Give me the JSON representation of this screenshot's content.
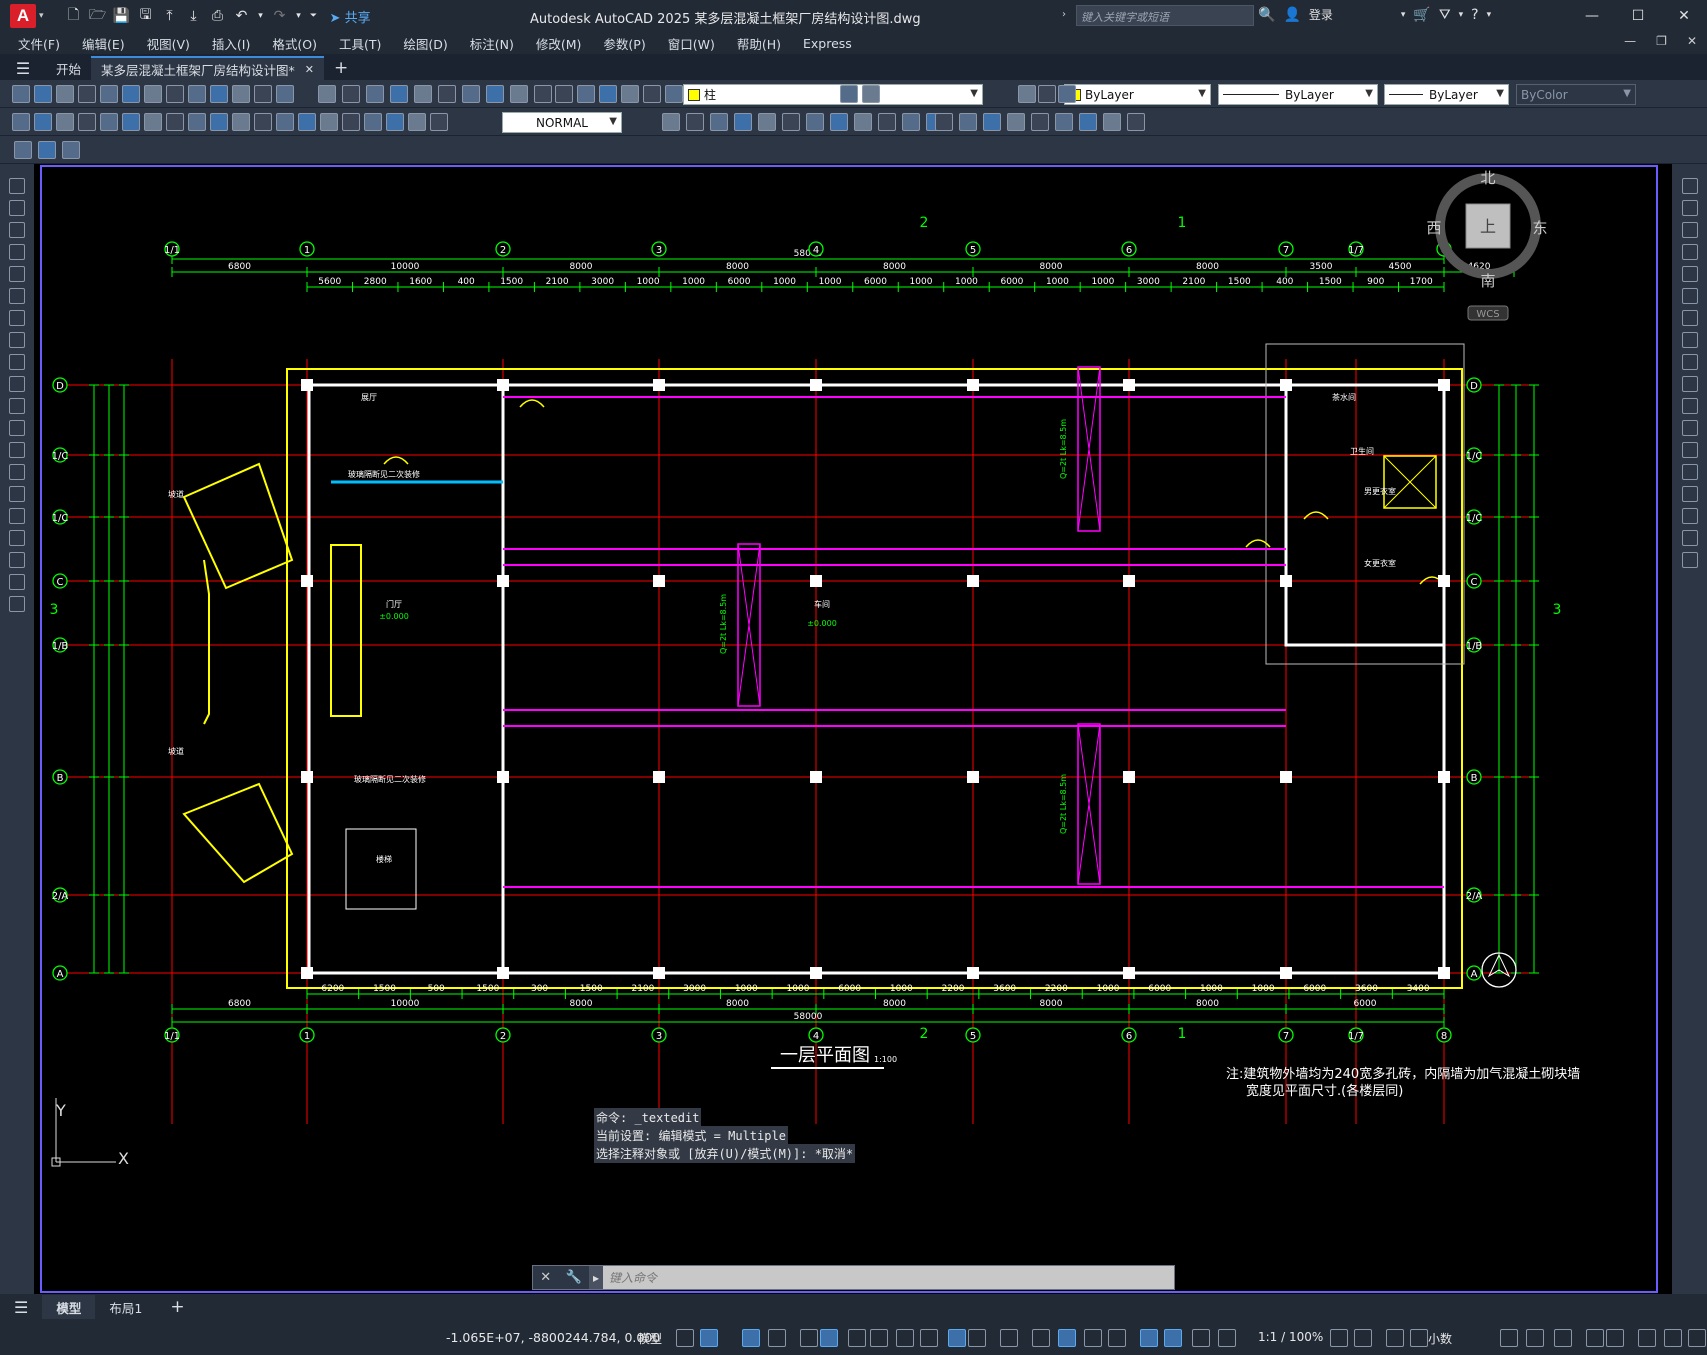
{
  "app": {
    "title": "Autodesk AutoCAD 2025    某多层混凝土框架厂房结构设计图.dwg",
    "logo": "A",
    "share": "共享",
    "search_placeholder": "键入关键字或短语",
    "login": "登录",
    "search_icon": "search-icon",
    "colors": {
      "accent": "#3c8cdc",
      "canvas": "#000000",
      "ui": "#2d3645",
      "axis_green": "#00ff00",
      "wall_yellow": "#ffff00",
      "grid_red": "#ff0000",
      "beam_magenta": "#ff00ff"
    }
  },
  "menu": [
    "文件(F)",
    "编辑(E)",
    "视图(V)",
    "插入(I)",
    "格式(O)",
    "工具(T)",
    "绘图(D)",
    "标注(N)",
    "修改(M)",
    "参数(P)",
    "窗口(W)",
    "帮助(H)",
    "Express"
  ],
  "tabs": {
    "start": "开始",
    "doc": "某多层混凝土框架厂房结构设计图*",
    "add": "+"
  },
  "toolbar": {
    "layer": "柱",
    "color": "ByLayer",
    "linetype": "ByLayer",
    "lineweight": "ByLayer",
    "plotstyle": "ByColor",
    "textstyle": "NORMAL"
  },
  "drawing": {
    "title": "一层平面图",
    "scale": "1:100",
    "note_line1": "注:建筑物外墙均为240宽多孔砖，内隔墙为加气混凝土砌块墙",
    "note_line2": "宽度见平面尺寸.(各楼层同)",
    "axes_x": [
      "1/1",
      "1",
      "2",
      "3",
      "4",
      "5",
      "6",
      "7",
      "1/7",
      "8"
    ],
    "axes_y": [
      "D",
      "1/C",
      "1/C",
      "C",
      "1/B",
      "B",
      "2/A",
      "A"
    ],
    "dims_top_total": "58000",
    "dims_top_row2": [
      "6800",
      "10000",
      "8000",
      "8000",
      "8000",
      "8000",
      "8000",
      "3500",
      "4500",
      "4620"
    ],
    "dims_top_row3": [
      "5600",
      "2800",
      "1600",
      "400",
      "1500",
      "2100",
      "3000",
      "1000",
      "1000",
      "6000",
      "1000",
      "1000",
      "6000",
      "1000",
      "1000",
      "6000",
      "1000",
      "1000",
      "3000",
      "2100",
      "1500",
      "400",
      "1500",
      "900",
      "1700"
    ],
    "dims_bottom_row1": [
      "6200",
      "1500",
      "500",
      "1500",
      "300",
      "1500",
      "2100",
      "3000",
      "1000",
      "1000",
      "6000",
      "1000",
      "2200",
      "3600",
      "2200",
      "1000",
      "6000",
      "1000",
      "1000",
      "6000",
      "3600",
      "3400"
    ],
    "dims_bottom_row2": [
      "6800",
      "10000",
      "8000",
      "8000",
      "8000",
      "8000",
      "8000",
      "6000"
    ],
    "dims_bottom_total": "58000",
    "rooms": {
      "hall": "展厅",
      "lobby": "门厅",
      "workshop": "车间",
      "stair": "楼梯",
      "ramp": "坡道",
      "toilet_m": "男更衣室",
      "toilet_f": "女更衣室",
      "tea": "茶水间",
      "wc": "卫生间"
    },
    "level_lobby": "±0.000",
    "level_workshop": "±0.000",
    "crane_text": "Q=2t Lk=8.5m",
    "compass": {
      "north": "北",
      "south": "南",
      "east": "东",
      "west": "西",
      "top": "上",
      "wcs": "WCS"
    },
    "side_labels": {
      "left": "3",
      "right": "3",
      "sec_top_2": "2",
      "sec_top_1": "1",
      "sec_bot_2": "2",
      "sec_bot_1": "1"
    },
    "glass_note": "玻璃隔断见二次装修"
  },
  "command": {
    "history": [
      "命令: _textedit",
      "当前设置: 编辑模式 = Multiple",
      "选择注释对象或 [放弃(U)/模式(M)]: *取消*"
    ],
    "placeholder": "键入命令"
  },
  "layouts": [
    "模型",
    "布局1"
  ],
  "status": {
    "coords": "-1.065E+07, -8800244.784, 0.000",
    "model": "模型",
    "scale": "1:1 / 100%",
    "units": "小数"
  }
}
